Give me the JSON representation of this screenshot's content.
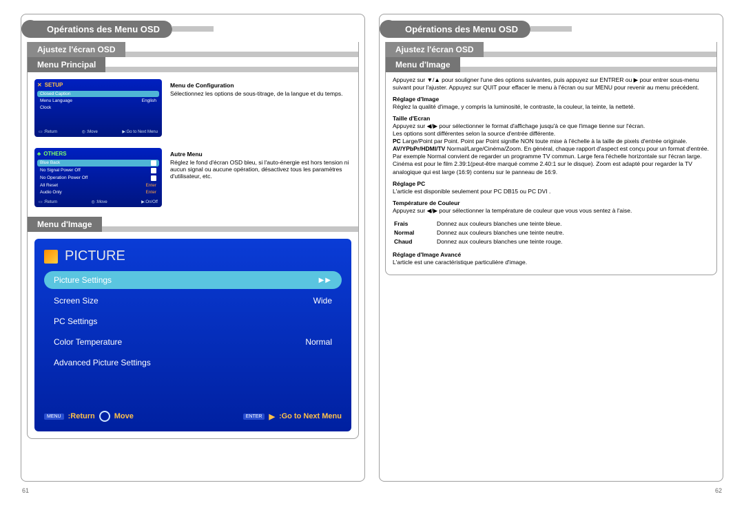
{
  "header_title": "Opérations des Menu OSD",
  "subhead": "Ajustez l'écran OSD",
  "left": {
    "section1": "Menu Principal",
    "section2": "Menu d'Image",
    "setup_title": "SETUP",
    "setup_rows": [
      {
        "l": "Closed Caption",
        "r": ""
      },
      {
        "l": "Menu Language",
        "r": "English"
      },
      {
        "l": "Clock",
        "r": ""
      }
    ],
    "setup_foot_l": "Return",
    "setup_foot_m": "Move",
    "setup_foot_r": "Go to Next Menu",
    "others_title": "OTHERS",
    "others_rows": [
      {
        "l": "Blue Back",
        "r": "chk"
      },
      {
        "l": "No Signal Power Off",
        "r": "chk"
      },
      {
        "l": "No Operation Power Off",
        "r": "chk"
      },
      {
        "l": "All Reset",
        "r": ""
      },
      {
        "l": "Audio Only",
        "r": ""
      }
    ],
    "others_foot_l": "Return",
    "others_foot_m": "Move",
    "others_foot_r": "On/Off",
    "config_h": "Menu de Configuration",
    "config_p": "Sélectionnez les options de sous-titrage, de la langue et du temps.",
    "other_h": "Autre Menu",
    "other_p": "Réglez le fond d'écran OSD bleu, si l'auto-énergie est hors tension ni aucun signal ou aucune opération, désactivez tous les paramètres d'utilisateur, etc.",
    "pic_title": "PICTURE",
    "pic_rows": [
      {
        "l": "Picture Settings",
        "r": "▶▶",
        "hl": true
      },
      {
        "l": "Screen Size",
        "r": "Wide"
      },
      {
        "l": "PC Settings",
        "r": ""
      },
      {
        "l": "Color Temperature",
        "r": "Normal"
      },
      {
        "l": "Advanced Picture Settings",
        "r": ""
      }
    ],
    "pic_foot_return_btn": "MENU",
    "pic_foot_return": ":Return",
    "pic_foot_move": "Move",
    "pic_foot_enter_btn": "ENTER",
    "pic_foot_next": ":Go to Next Menu",
    "pagenum": "61"
  },
  "right": {
    "section": "Menu d'Image",
    "intro": "Appuyez sur ▼/▲ pour souligner l'une des options suivantes, puis appuyez sur ENTRER ou ▶ pour entrer sous-menu suivant pour l'ajuster.  Appuyez sur QUIT pour effacer le menu à l'écran ou sur MENU pour revenir au menu précédent.",
    "h1": "Réglage d'Image",
    "p1": "Réglez la qualité d'image, y compris la luminosité, le contraste, la couleur, la teinte, la netteté.",
    "h2": "Taille d'Ecran",
    "p2a": "Appuyez sur ◀/▶ pour sélectionner le format d'affichage jusqu'à ce que l'image tienne sur l'écran.",
    "p2b": "Les options sont différentes selon la source d'entrée différente.",
    "p2c1": "PC",
    "p2c2": " Large/Point par Point. Point par Point signifie NON toute mise à l'échelle à la taille de pixels d'entrée originale.",
    "p2d1": "AV/YPbPr/HDMI/TV",
    "p2d2": " Normal/Large/Cinéma/Zoom.  En général, chaque rapport d'aspect est conçu pour un format d'entrée.",
    "p2e": "Par exemple Normal convient de regarder un programme TV commun. Large fera l'échelle horizontale sur l'écran large.",
    "p2f": "Cinéma est pour le film 2.39:1(peut-être marqué comme 2.40:1 sur le disque). Zoom est adapté pour regarder la TV analogique qui est large (16:9) contenu sur le panneau de 16:9.",
    "h3": "Réglage PC",
    "p3": "L'article est disponible seulement pour PC DB15 ou PC DVI .",
    "h4": "Température de Couleur",
    "p4": "Appuyez sur ◀/▶ pour sélectionner la température de couleur que vous vous sentez à l'aise.",
    "t_frais_l": "Frais",
    "t_frais_v": "Donnez aux couleurs blanches une teinte bleue.",
    "t_normal_l": "Normal",
    "t_normal_v": "Donnez aux couleurs blanches une teinte neutre.",
    "t_chaud_l": "Chaud",
    "t_chaud_v": "Donnez aux couleurs blanches une teinte rouge.",
    "h5": "Réglage d'Image Avancé",
    "p5": "L'article est une caractéristique particulière d'image.",
    "pagenum": "62"
  }
}
